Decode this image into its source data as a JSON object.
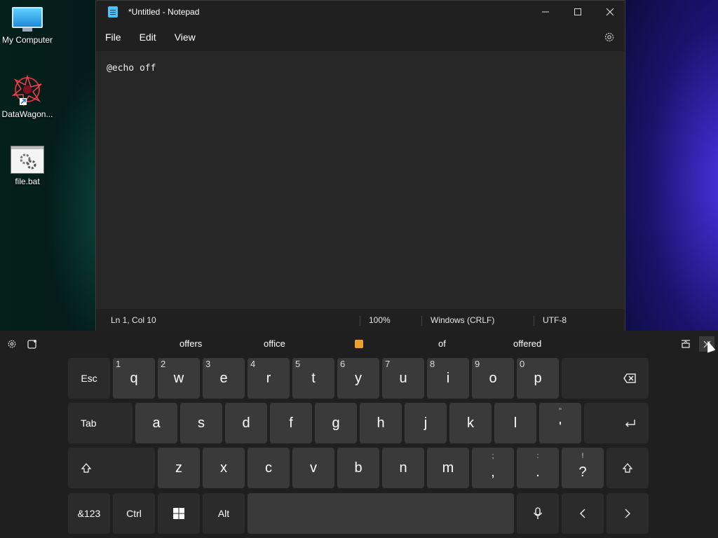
{
  "desktop": {
    "icons": [
      {
        "label": "My Computer",
        "icon": "computer-icon"
      },
      {
        "label": "DataWagon...",
        "icon": "datawagon-app-icon"
      },
      {
        "label": "file.bat",
        "icon": "batch-file-icon"
      }
    ]
  },
  "window": {
    "title": "*Untitled - Notepad",
    "icon": "notepad-icon"
  },
  "menu": [
    "File",
    "Edit",
    "View"
  ],
  "editor": {
    "text": "@echo off"
  },
  "status": {
    "position": "Ln 1, Col 10",
    "zoom": "100%",
    "line_ending": "Windows (CRLF)",
    "encoding": "UTF-8"
  },
  "keyboard": {
    "suggestions": [
      "offers",
      "office",
      "of",
      "offered"
    ],
    "row1": [
      "Esc",
      "q",
      "w",
      "e",
      "r",
      "t",
      "y",
      "u",
      "i",
      "o",
      "p"
    ],
    "row1_nums": [
      "1",
      "2",
      "3",
      "4",
      "5",
      "6",
      "7",
      "8",
      "9",
      "0"
    ],
    "row2": [
      "Tab",
      "a",
      "s",
      "d",
      "f",
      "g",
      "h",
      "j",
      "k",
      "l",
      "'"
    ],
    "row2_sub": [
      "\""
    ],
    "row3": [
      "z",
      "x",
      "c",
      "v",
      "b",
      "n",
      "m",
      ",",
      ".",
      "?"
    ],
    "row3_sub": [
      ";",
      ":",
      "!"
    ],
    "row4": [
      "&123",
      "Ctrl",
      "Alt"
    ]
  },
  "colors": {
    "window_bg": "#202020",
    "editor_bg": "#272727",
    "key_bg": "#3a3a3a",
    "key_dark_bg": "#2b2b2b",
    "keyboard_bg": "#1f1f1f"
  }
}
